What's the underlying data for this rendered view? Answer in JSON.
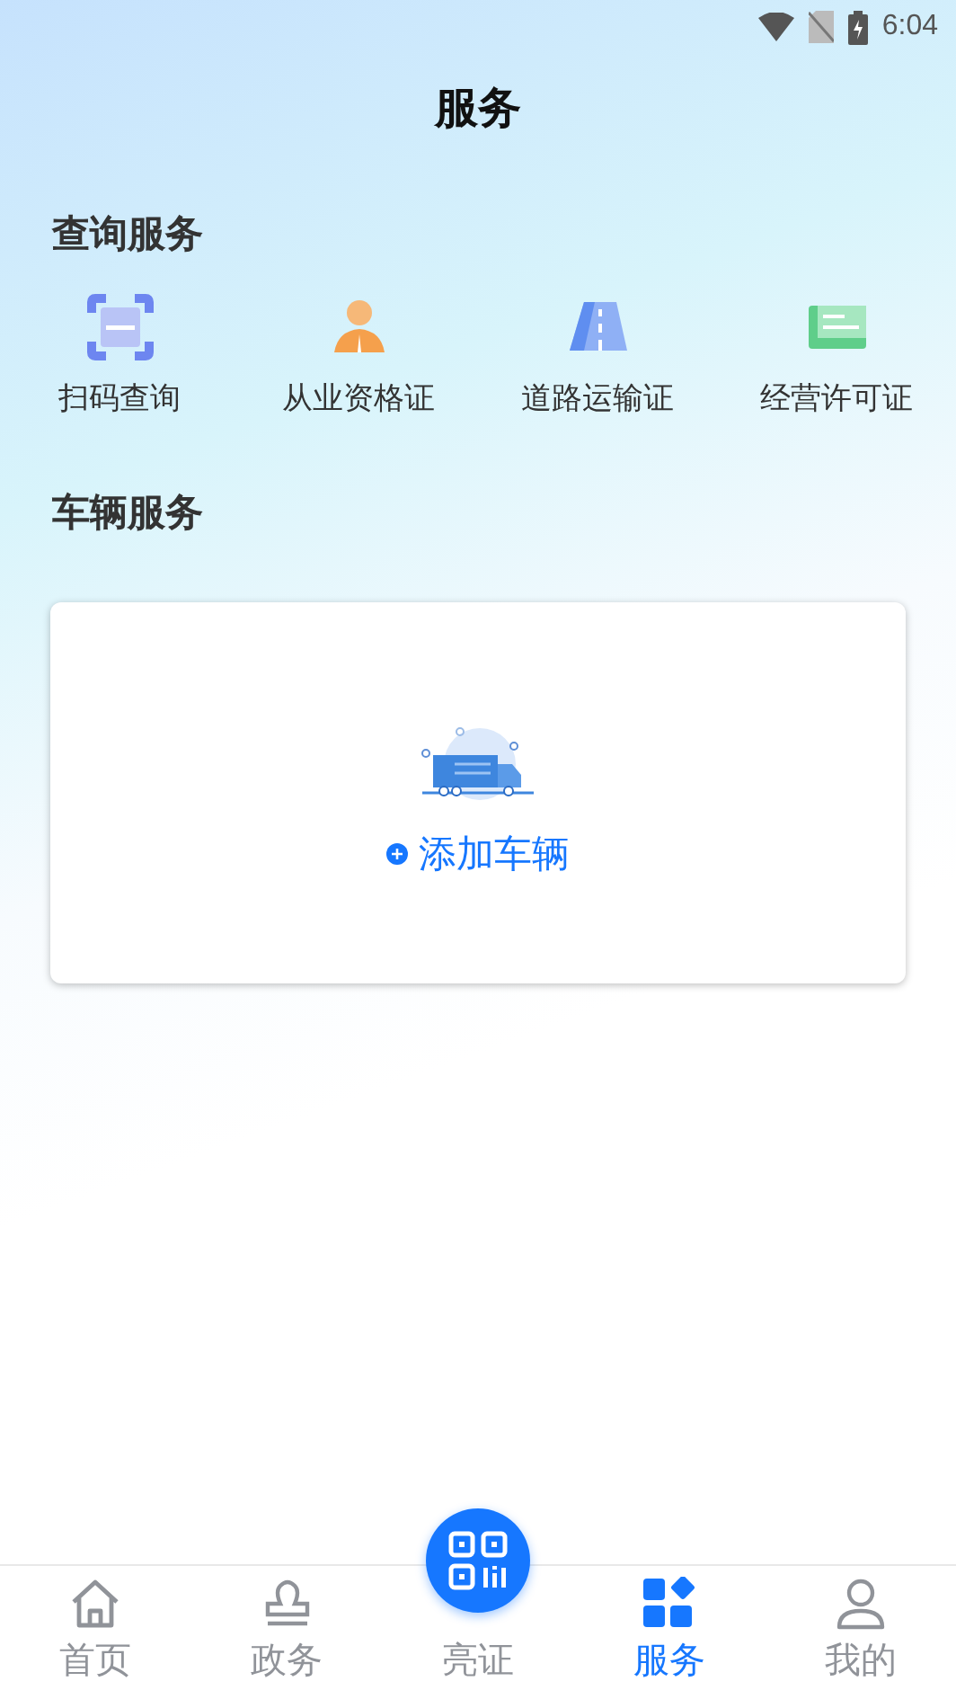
{
  "status_bar": {
    "time": "6:04"
  },
  "title": "服务",
  "query_section": {
    "heading": "查询服务",
    "items": [
      {
        "label": "扫码查询",
        "kind": "scan"
      },
      {
        "label": "从业资格证",
        "kind": "person"
      },
      {
        "label": "道路运输证",
        "kind": "road"
      },
      {
        "label": "经营许可证",
        "kind": "license"
      }
    ]
  },
  "vehicle_section": {
    "heading": "车辆服务",
    "add_button": "添加车辆"
  },
  "tab_bar": [
    {
      "label": "首页",
      "kind": "home",
      "selected": false
    },
    {
      "label": "政务",
      "kind": "stamp",
      "selected": false
    },
    {
      "label": "亮证",
      "kind": "qr",
      "selected": false
    },
    {
      "label": "服务",
      "kind": "grid",
      "selected": true
    },
    {
      "label": "我的",
      "kind": "user",
      "selected": false
    }
  ]
}
